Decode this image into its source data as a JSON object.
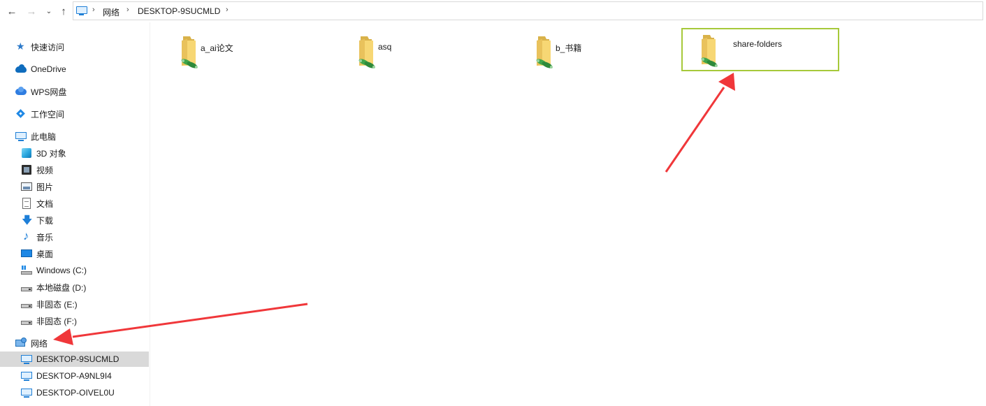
{
  "address_bar": {
    "back_icon": "arrow-left",
    "forward_icon": "arrow-right",
    "recent_icon": "chevron-down",
    "up_icon": "arrow-up",
    "breadcrumbs": [
      "网络",
      "DESKTOP-9SUCMLD"
    ]
  },
  "sidebar": {
    "quick_access": "快速访问",
    "onedrive": "OneDrive",
    "wps": "WPS网盘",
    "workspace": "工作空间",
    "this_pc": "此电脑",
    "pc_items": [
      "3D 对象",
      "视频",
      "图片",
      "文档",
      "下载",
      "音乐",
      "桌面",
      "Windows (C:)",
      "本地磁盘 (D:)",
      "非固态 (E:)",
      "非固态 (F:)"
    ],
    "network": "网络",
    "network_items": [
      "DESKTOP-9SUCMLD",
      "DESKTOP-A9NL9I4",
      "DESKTOP-OIVEL0U"
    ]
  },
  "content": {
    "folders": [
      {
        "name": "a_ai论文"
      },
      {
        "name": "asq"
      },
      {
        "name": "b_书籍"
      },
      {
        "name": "share-folders"
      }
    ]
  },
  "colors": {
    "highlight_box": "#a6c93a",
    "annotation_arrow": "#f0373a",
    "selected_row": "#d9d9d9"
  }
}
